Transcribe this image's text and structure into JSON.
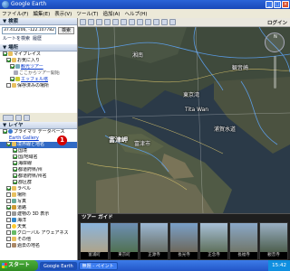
{
  "window": {
    "title": "Google Earth"
  },
  "menu": [
    "ファイル(F)",
    "編集(E)",
    "表示(V)",
    "ツール(T)",
    "追加(A)",
    "ヘルプ(H)"
  ],
  "toolbar": {
    "login": "ログイン"
  },
  "search": {
    "header": "▼ 検索",
    "input_value": "37.412206, -122.107782",
    "search_button": "検索",
    "route_link": "ルートを検索",
    "history_link": "履歴"
  },
  "places": {
    "header": "▼ 場所",
    "items": [
      "マイプレイス",
      "お気に入り",
      "観光ツアー",
      "ここからツアー開始",
      "エッフェル塔",
      "保存済みの場所"
    ]
  },
  "layers": {
    "header": "▼ レイヤ",
    "primary_db": "プライマリ データベース",
    "sub": "Earth Gallery",
    "items": [
      "境界線と地名",
      "国境",
      "国/地域名",
      "海岸線",
      "都道府県/州",
      "都道府県/州名",
      "郡区群",
      "ラベル",
      "場所",
      "写真",
      "道路",
      "建物の 3D 表示",
      "海洋",
      "天気",
      "グローバル アウェアネス",
      "その他",
      "過去の地名"
    ]
  },
  "annotation": {
    "number": "1"
  },
  "map_labels": [
    "富津市",
    "富津岬",
    "Tita Wan",
    "東京湾",
    "浦賀水道",
    "観音崎",
    "湘南"
  ],
  "tour": {
    "header": "ツアー ガイド",
    "items": [
      "富浦町",
      "東京町",
      "正源寺",
      "長光寺",
      "正念寺",
      "長福寺",
      "観音寺"
    ]
  },
  "taskbar": {
    "start": "スタート",
    "tasks": [
      "Google Earth",
      "無題 - ペイント"
    ],
    "clock": "15:42"
  },
  "colors": {
    "accent": "#2a64d8",
    "badge": "#d40000",
    "water": "#2b3a48"
  }
}
